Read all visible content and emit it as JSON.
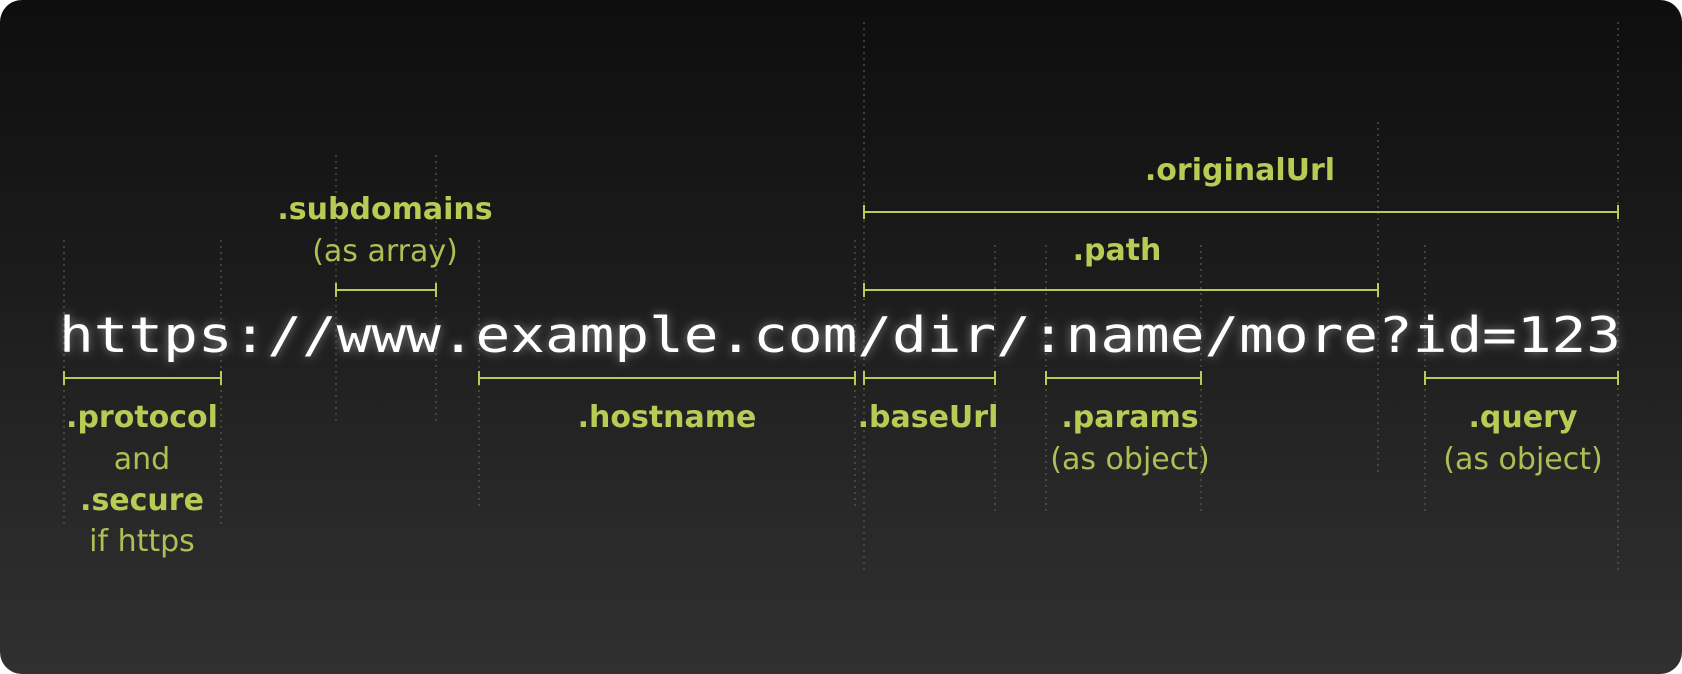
{
  "url": {
    "parts": [
      {
        "id": "protocol",
        "text": "https:"
      },
      {
        "id": "slashes",
        "text": "//"
      },
      {
        "id": "subdomain",
        "text": "www"
      },
      {
        "id": "dot1",
        "text": "."
      },
      {
        "id": "domain",
        "text": "example.com"
      },
      {
        "id": "base",
        "text": "/dir"
      },
      {
        "id": "slash2",
        "text": "/"
      },
      {
        "id": "param",
        "text": ":name"
      },
      {
        "id": "more",
        "text": "/more"
      },
      {
        "id": "qmark",
        "text": "?"
      },
      {
        "id": "query",
        "text": "id=123"
      }
    ]
  },
  "labels": {
    "original_url": ".originalUrl",
    "path": ".path",
    "subdomains": ".subdomains",
    "subdomains_note": "(as array)",
    "protocol": ".protocol",
    "protocol_and": "and",
    "secure": ".secure",
    "secure_note": "if https",
    "hostname": ".hostname",
    "base_url": ".baseUrl",
    "params": ".params",
    "params_note": "(as object)",
    "query": ".query",
    "query_note": "(as object)"
  },
  "colors": {
    "accent": "#b7cc55",
    "url_text": "#ffffff",
    "guide_line": "#5a5f3a",
    "background_top": "#0e0e0e",
    "background_bottom": "#303030"
  }
}
